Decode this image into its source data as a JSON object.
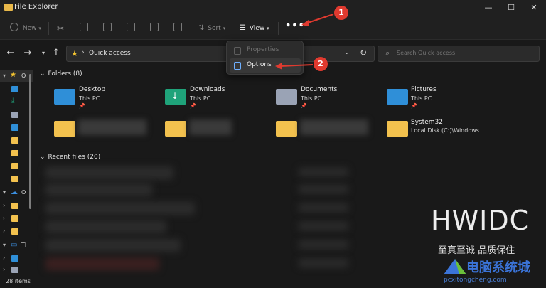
{
  "window": {
    "title": "File Explorer"
  },
  "window_controls": {
    "minimize": "—",
    "maximize": "☐",
    "close": "✕"
  },
  "toolbar": {
    "new_label": "New",
    "sort_label": "Sort",
    "view_label": "View",
    "more_label": "•••"
  },
  "address": {
    "location": "Quick access",
    "star": "★"
  },
  "search": {
    "placeholder": "Search Quick access"
  },
  "nav_pane": {
    "items": [
      {
        "label": "Q",
        "icon": "star-icon"
      },
      {
        "label": "O",
        "icon": "cloud-icon"
      },
      {
        "label": "Tl",
        "icon": "pc-icon"
      }
    ]
  },
  "folders_section": {
    "label": "Folders (8)"
  },
  "folders": [
    {
      "name": "Desktop",
      "location": "This PC",
      "icon": "desktop-folder-icon",
      "color": "#2f8fd8"
    },
    {
      "name": "Downloads",
      "location": "This PC",
      "icon": "downloads-folder-icon",
      "color": "#1fa37a"
    },
    {
      "name": "Documents",
      "location": "This PC",
      "icon": "documents-folder-icon",
      "color": "#9aa3b5"
    },
    {
      "name": "Pictures",
      "location": "This PC",
      "icon": "pictures-folder-icon",
      "color": "#2f8fd8"
    },
    {
      "name": "",
      "location": "",
      "icon": "folder-icon",
      "color": "#f2c14e"
    },
    {
      "name": "",
      "location": "",
      "icon": "folder-icon",
      "color": "#f2c14e"
    },
    {
      "name": "",
      "location": "",
      "icon": "folder-icon",
      "color": "#f2c14e"
    },
    {
      "name": "System32",
      "location": "Local Disk (C:)\\Windows",
      "icon": "folder-icon",
      "color": "#f2c14e"
    }
  ],
  "recent_section": {
    "label": "Recent files (20)"
  },
  "menu": {
    "items": [
      {
        "label": "Properties",
        "enabled": false
      },
      {
        "label": "Options",
        "enabled": true
      }
    ]
  },
  "annotations": {
    "step1": "1",
    "step2": "2",
    "arrow_color": "#e03a2f"
  },
  "status": {
    "item_count": "28 items"
  },
  "watermark": {
    "brand": "HWIDC",
    "slogan": "至真至诚 品质保住",
    "site_name": "电脑系统城",
    "site_url": "pcxitongcheng.com"
  }
}
